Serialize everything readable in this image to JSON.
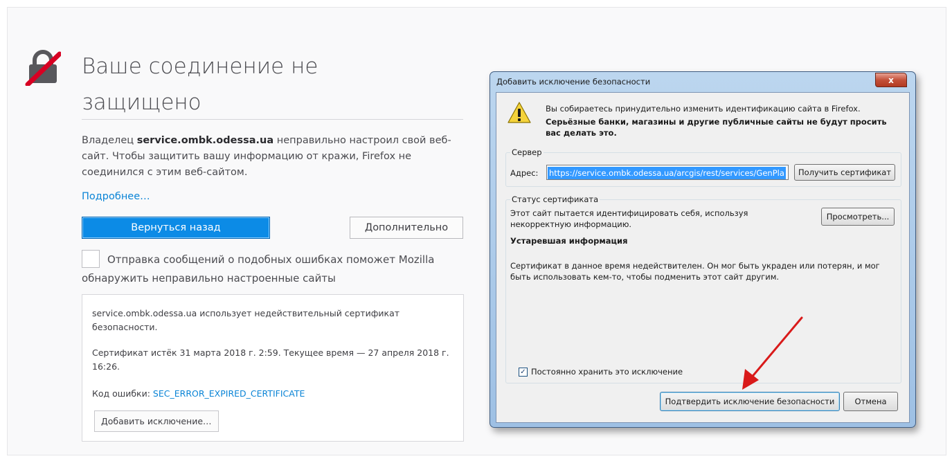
{
  "error_page": {
    "title": "Ваше соединение не защищено",
    "intro_prefix": "Владелец ",
    "intro_domain": "service.ombk.odessa.ua",
    "intro_suffix": " неправильно настроил свой веб-сайт. Чтобы защитить вашу информацию от кражи, Firefox не соединился с этим веб-сайтом.",
    "learn_more_link": "Подробнее…",
    "go_back_button": "Вернуться назад",
    "advanced_button": "Дополнительно",
    "report_checkbox_label": "Отправка сообщений о подобных ошибках поможет Mozilla обнаружить неправильно настроенные сайты",
    "report_checked": false,
    "details": {
      "invalid_cert_text": "service.ombk.odessa.ua использует недействительный сертификат безопасности.",
      "expired_text": "Сертификат истёк 31 марта 2018 г. 2:59. Текущее время — 27 апреля 2018 г. 16:26.",
      "error_code_label": "Код ошибки: ",
      "error_code": "SEC_ERROR_EXPIRED_CERTIFICATE",
      "add_exception_button": "Добавить исключение…"
    }
  },
  "dialog": {
    "title": "Добавить исключение безопасности",
    "close_glyph": "x",
    "warning_line1": "Вы собираетесь принудительно изменить идентификацию сайта в Firefox.",
    "warning_line2": "Серьёзные банки, магазины и другие публичные сайты не будут просить вас делать это.",
    "server_group": "Сервер",
    "address_label": "Адрес:",
    "address_value": "https://service.ombk.odessa.ua/arcgis/rest/services/GenPla",
    "get_certificate_button": "Получить сертификат",
    "status_group": "Статус сертификата",
    "status_text": "Этот сайт пытается идентифицировать себя, используя некорректную информацию.",
    "view_button": "Просмотреть...",
    "outdated_heading": "Устаревшая информация",
    "outdated_text": "Сертификат в данное время недействителен. Он мог быть украден или потерян, и мог быть использовать кем-то, чтобы подменить этот сайт другим.",
    "keep_exception_label": "Постоянно хранить это исключение",
    "keep_exception_checked": true,
    "confirm_button": "Подтвердить исключение безопасности",
    "cancel_button": "Отмена"
  },
  "colors": {
    "link": "#0a84d6",
    "primary_button": "#0c8be6",
    "arrow": "#d91a1a"
  },
  "icons": [
    "broken-lock-icon",
    "warning-icon",
    "close-icon",
    "checkmark-icon",
    "annotation-arrow-icon"
  ]
}
